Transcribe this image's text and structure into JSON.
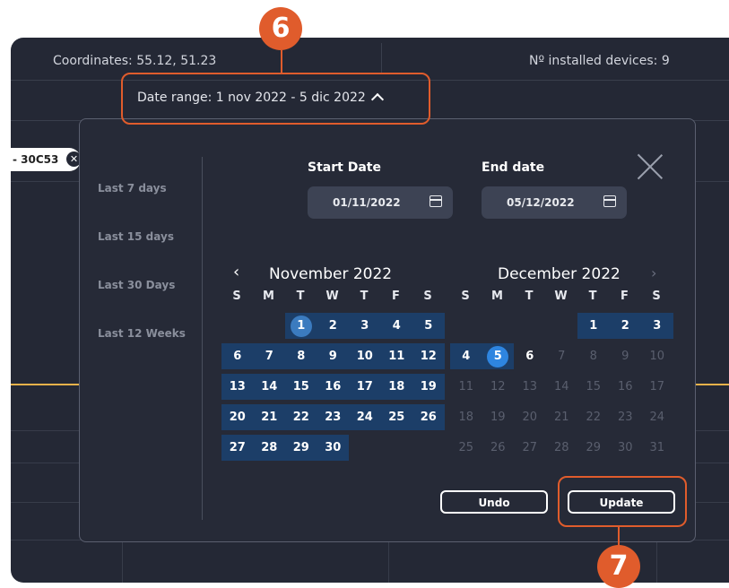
{
  "header": {
    "coordinates": "Coordinates: 55.12, 51.23",
    "installed_devices": "Nº installed devices: 9",
    "date_range": "Date range:  1 nov 2022 - 5 dic 2022"
  },
  "chip": {
    "label": "- 30C53"
  },
  "picker": {
    "presets": [
      "Last 7 days",
      "Last 15 days",
      "Last 30 Days",
      "Last 12 Weeks"
    ],
    "start_label": "Start Date",
    "end_label": "End date",
    "start_value": "01/11/2022",
    "end_value": "05/12/2022",
    "weekdays": [
      "S",
      "M",
      "T",
      "W",
      "T",
      "F",
      "S"
    ],
    "months": [
      {
        "title": "November 2022",
        "nav": "‹",
        "first_weekday": 2,
        "days": 30,
        "selected_from": 1,
        "selected_to": 30,
        "highlight": 1,
        "highlight_color": "#3b7bbf"
      },
      {
        "title": "December 2022",
        "nav": "›",
        "first_weekday": 4,
        "days": 31,
        "selected_from": 1,
        "selected_to": 5,
        "highlight": 5,
        "highlight_color": "#2e85e0"
      }
    ],
    "undo_label": "Undo",
    "update_label": "Update"
  },
  "callouts": {
    "top_number": "6",
    "bottom_number": "7"
  },
  "colors": {
    "callout": "#e05c2c",
    "range": "#1c3e68",
    "background": "#242835"
  }
}
